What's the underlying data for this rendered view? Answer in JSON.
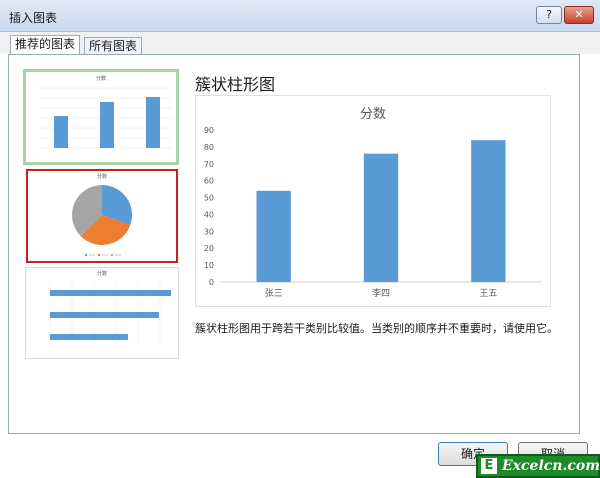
{
  "window": {
    "title": "插入图表",
    "help_label": "?",
    "close_label": "✕"
  },
  "tabs": [
    {
      "label": "推荐的图表",
      "active": true
    },
    {
      "label": "所有图表",
      "active": false
    }
  ],
  "thumbnails": [
    {
      "kind": "clustered-column",
      "title": "分数",
      "selected": false
    },
    {
      "kind": "pie",
      "title": "分数",
      "selected": true
    },
    {
      "kind": "clustered-bar",
      "title": "分数",
      "selected": false
    }
  ],
  "selected_chart": {
    "name": "簇状柱形图",
    "description": "簇状柱形图用于跨若干类别比较值。当类别的顺序并不重要时，请使用它。"
  },
  "chart_data": {
    "type": "bar",
    "title": "分数",
    "categories": [
      "张三",
      "李四",
      "王五"
    ],
    "values": [
      54,
      76,
      84
    ],
    "ylim": [
      0,
      90
    ],
    "yticks": [
      "90",
      "80",
      "70",
      "60",
      "50",
      "40",
      "30",
      "20",
      "10",
      "0"
    ],
    "grid": false,
    "bar_color": "#5b9bd5"
  },
  "pie_colors": [
    "#5b9bd5",
    "#ed7d31",
    "#a5a5a5"
  ],
  "buttons": {
    "ok": "确定",
    "cancel": "取消"
  },
  "watermark": {
    "mark": "E",
    "text": "Excelcn.com",
    "color": "#1e8a2a"
  }
}
